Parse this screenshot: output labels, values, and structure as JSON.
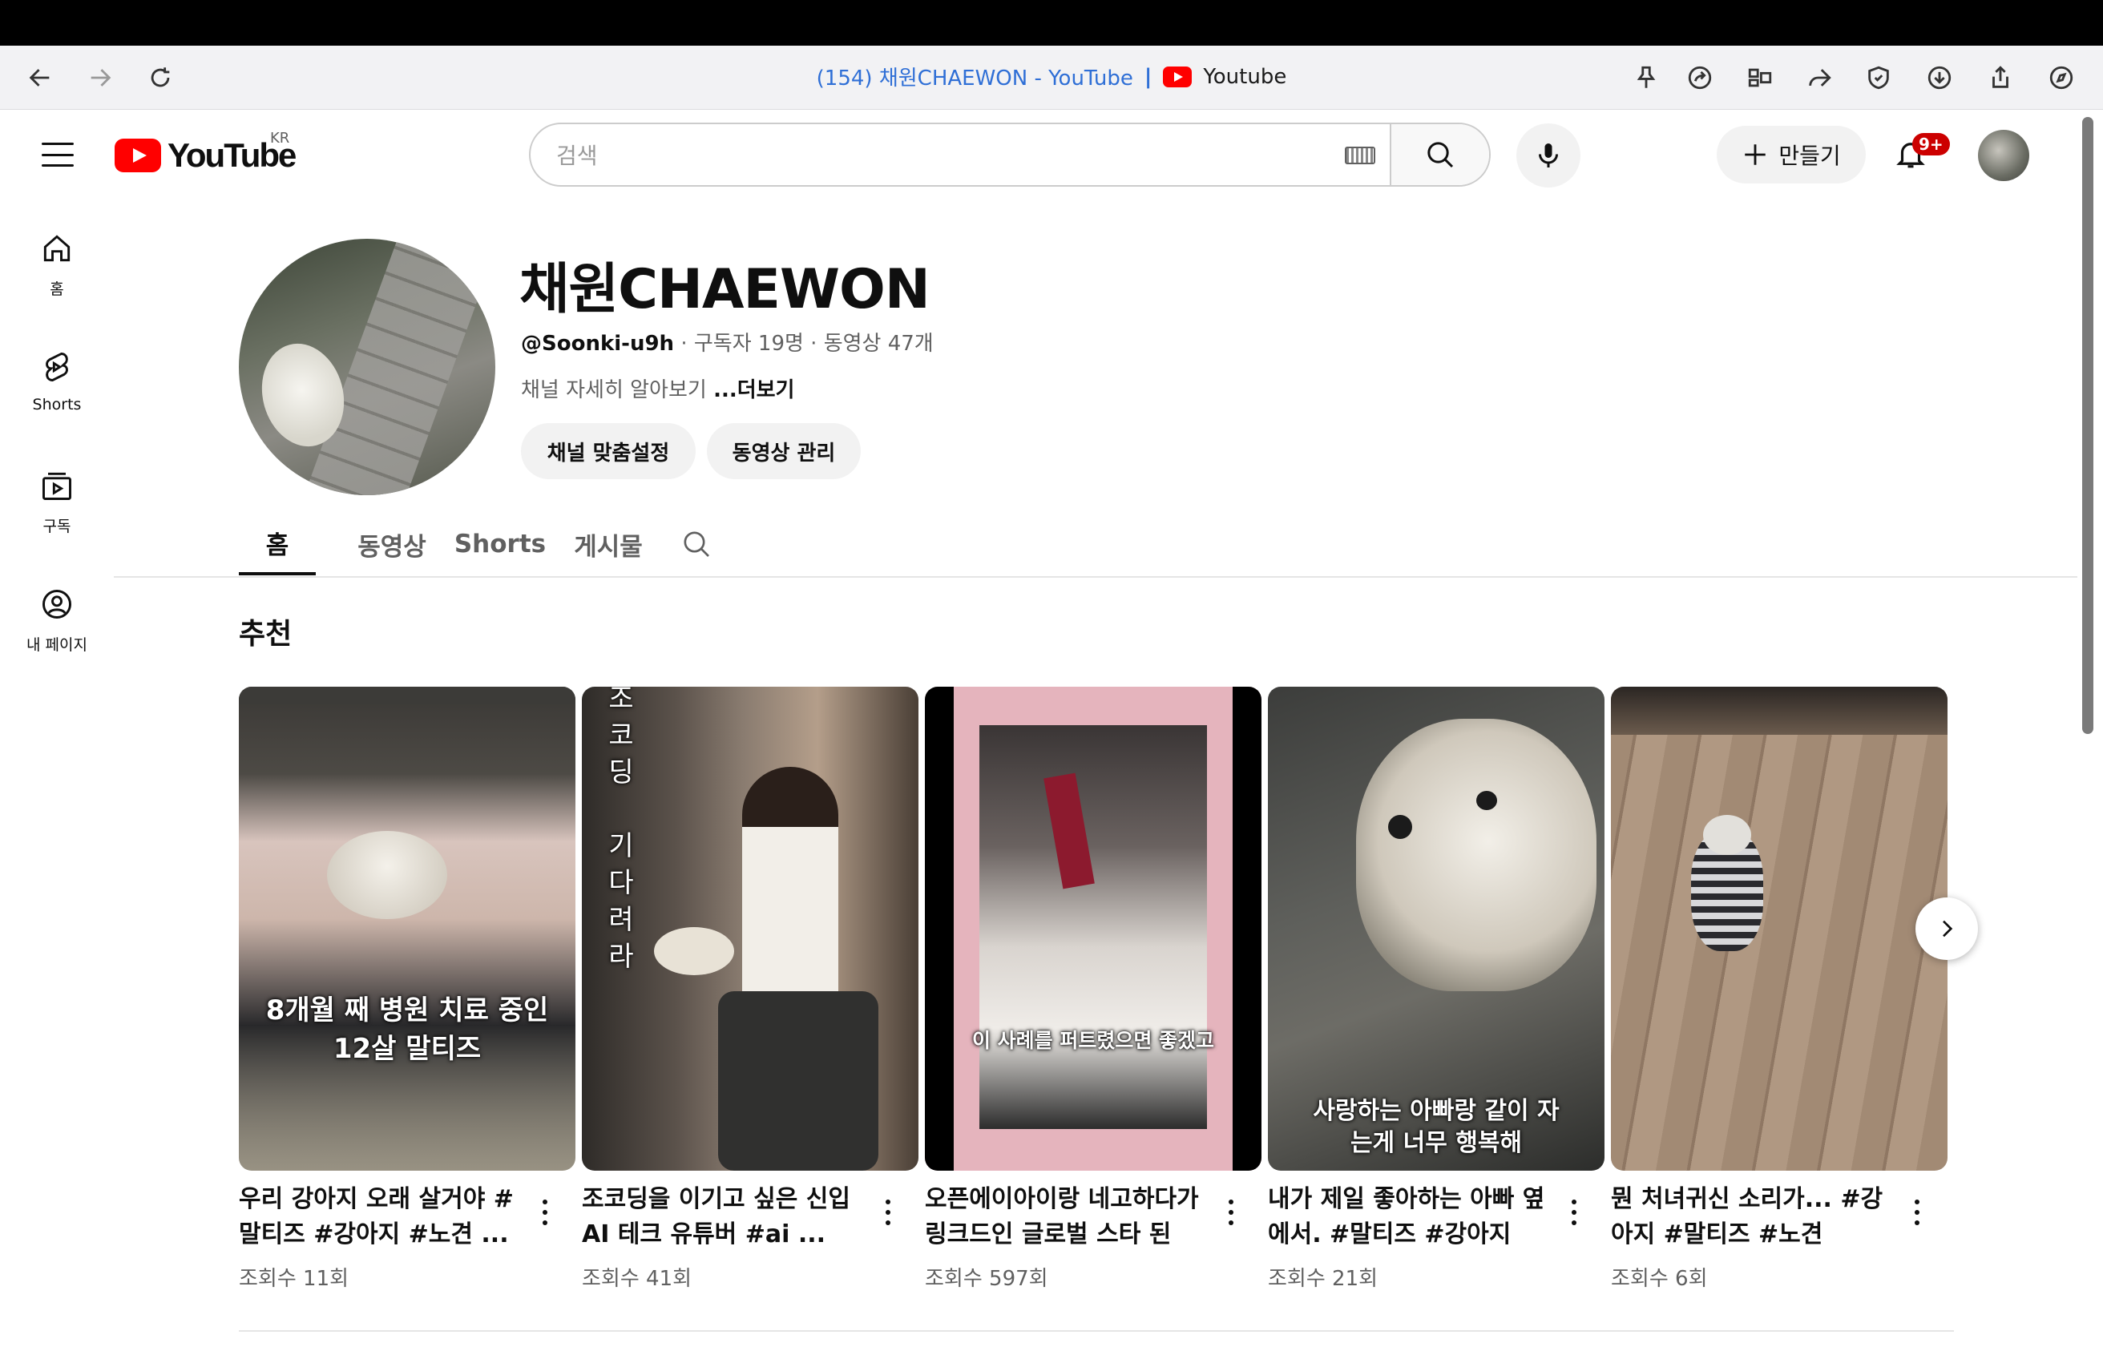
{
  "browser": {
    "tab_url_title": "(154) 채원CHAEWON - YouTube",
    "separator": "|",
    "site_name": "Youtube"
  },
  "header": {
    "logo_text": "YouTube",
    "region": "KR",
    "search_placeholder": "검색",
    "create_label": "만들기",
    "notification_badge": "9+"
  },
  "guide": {
    "items": [
      {
        "label": "홈",
        "icon": "home-icon"
      },
      {
        "label": "Shorts",
        "icon": "shorts-icon"
      },
      {
        "label": "구독",
        "icon": "subscriptions-icon"
      },
      {
        "label": "내 페이지",
        "icon": "my-page-icon"
      }
    ]
  },
  "channel": {
    "name": "채원CHAEWON",
    "handle": "@Soonki-u9h",
    "meta": " · 구독자 19명 · 동영상 47개",
    "description": "채널 자세히 알아보기 ",
    "more": "...더보기",
    "customize_label": "채널 맞춤설정",
    "manage_label": "동영상 관리"
  },
  "tabs": [
    "홈",
    "동영상",
    "Shorts",
    "게시물"
  ],
  "section_title": "추천",
  "shorts": [
    {
      "title": "우리 강아지 오래 살거야 # 말티즈 #강아지 #노견 ...",
      "views": "조회수 11회",
      "caption": "8개월 째 병원 치료 중인\n12살 말티즈"
    },
    {
      "title": "조코딩을 이기고 싶은 신입 AI 테크 유튜버 #ai ...",
      "views": "조회수 41회",
      "caption": "조\n코\n딩\n\n기\n다\n려\n라"
    },
    {
      "title": "오픈에이아이랑 네고하다가 링크드인 글로벌 스타 된 ...",
      "views": "조회수 597회",
      "caption": "이 사례를 퍼트렸으면 좋겠고"
    },
    {
      "title": "내가 제일 좋아하는 아빠 옆에서. #말티즈 #강아지 #...",
      "views": "조회수 21회",
      "caption": "사랑하는 아빠랑 같이 자\n는게 너무 행복해"
    },
    {
      "title": "뭔 처녀귀신 소리가... #강아지 #말티즈 #노견",
      "views": "조회수 6회",
      "caption": ""
    }
  ],
  "colors": {
    "brand_red": "#ff0000",
    "link_blue": "#2f6fd6",
    "badge_red": "#cc0000"
  }
}
